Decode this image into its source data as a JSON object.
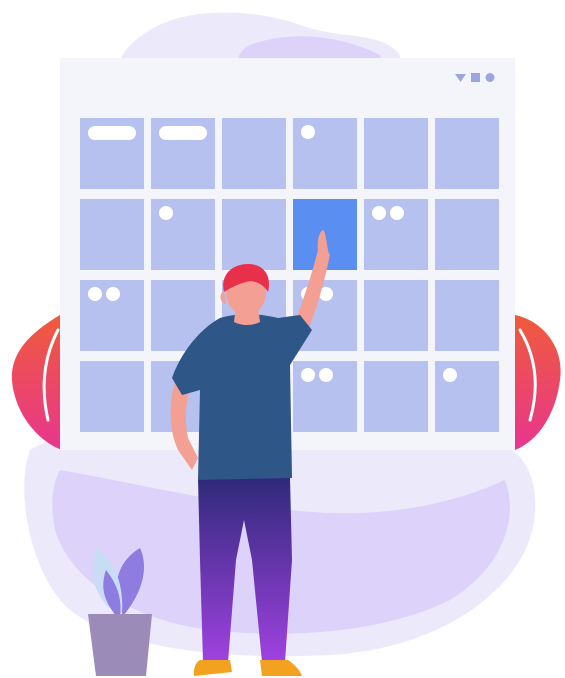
{
  "illustration": {
    "subject": "calendar-scheduling",
    "calendar": {
      "rows": 4,
      "columns": 6,
      "highlighted_cell": {
        "row": 2,
        "column": 4
      },
      "cells": [
        [
          "pill",
          "pill",
          "empty",
          "dot1",
          "empty",
          "empty"
        ],
        [
          "empty",
          "dot1",
          "empty",
          "highlight",
          "dot2",
          "empty"
        ],
        [
          "dot2",
          "empty",
          "empty",
          "dot2",
          "empty",
          "empty"
        ],
        [
          "empty",
          "empty",
          "empty",
          "dot2",
          "empty",
          "dot1"
        ]
      ],
      "window_controls": [
        "triangle-icon",
        "square-icon",
        "circle-icon"
      ]
    },
    "colors": {
      "background": "#ffffff",
      "blob_light": "#ece9fb",
      "blob_mid": "#ddd3fa",
      "blob_accent": "#c9b8f5",
      "board": "#f4f4fb",
      "cell": "#b7c1ef",
      "cell_highlight": "#5a8ef0",
      "event_marker": "#ffffff",
      "window_controls": "#9aa6dc",
      "shirt": "#2e5687",
      "skin": "#f39f93",
      "hair": "#e8304a",
      "pants_top": "#2f2a7a",
      "pants_bottom": "#a042e0",
      "shoes": "#f3a21f",
      "leaf_warm_top": "#ef5b3a",
      "leaf_warm_bottom": "#e8368f",
      "leaf_cool_light": "#c8dcf6",
      "leaf_cool_dark": "#8e7ce0",
      "pot": "#9b8bb8"
    }
  }
}
